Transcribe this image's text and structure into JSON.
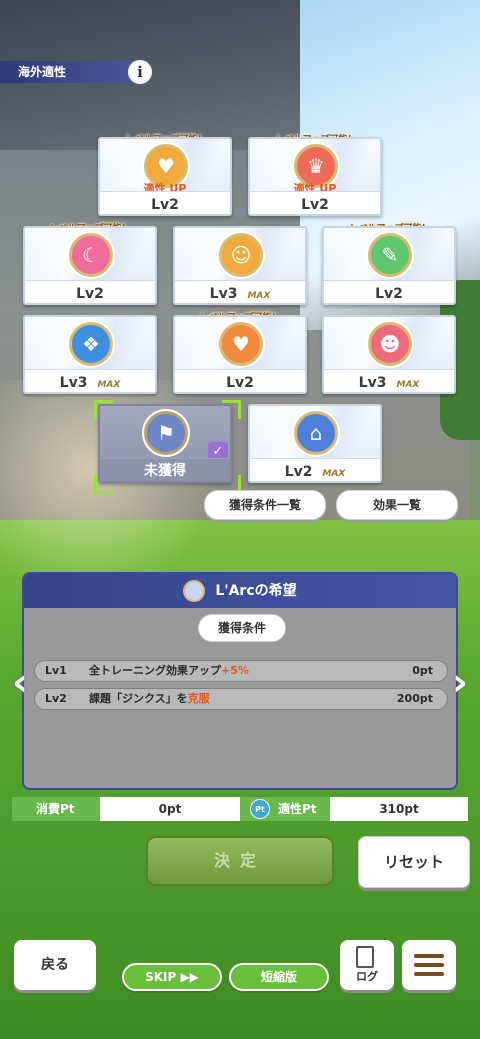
{
  "header": {
    "title": "海外適性",
    "info_icon": "i"
  },
  "cards": [
    {
      "id": "c1",
      "lvup": "レベルアップ可能！",
      "sub": "適性 UP",
      "level": "Lv2",
      "max": "",
      "icon": "heart-icon",
      "color": "#f2a93b"
    },
    {
      "id": "c2",
      "lvup": "レベルアップ可能！",
      "sub": "適性 UP",
      "level": "Lv2",
      "max": "",
      "icon": "crown-icon",
      "color": "#ee6a5b"
    },
    {
      "id": "c3",
      "lvup": "レベルアップ可能！",
      "sub": "",
      "level": "Lv2",
      "max": "",
      "icon": "moon-icon",
      "color": "#ef6c9c"
    },
    {
      "id": "c4",
      "lvup": "",
      "sub": "",
      "level": "Lv3",
      "max": "MAX",
      "icon": "rabbit-icon",
      "color": "#f2a93b"
    },
    {
      "id": "c5",
      "lvup": "レベルアップ可能！",
      "sub": "",
      "level": "Lv2",
      "max": "",
      "icon": "chat-icon",
      "color": "#5fc76e"
    },
    {
      "id": "c6",
      "lvup": "",
      "sub": "",
      "level": "Lv3",
      "max": "MAX",
      "icon": "cube-icon",
      "color": "#3f8fe0"
    },
    {
      "id": "c7",
      "lvup": "レベルアップ可能！",
      "sub": "",
      "level": "Lv2",
      "max": "",
      "icon": "heart-icon",
      "color": "#f28a3b"
    },
    {
      "id": "c8",
      "lvup": "",
      "sub": "",
      "level": "Lv3",
      "max": "MAX",
      "icon": "face-icon",
      "color": "#ee6a7a"
    },
    {
      "id": "c9",
      "lvup": "",
      "sub": "",
      "level": "未獲得",
      "max": "",
      "icon": "flag-icon",
      "color": "#6f85c8"
    },
    {
      "id": "c10",
      "lvup": "",
      "sub": "",
      "level": "Lv2",
      "max": "MAX",
      "icon": "arch-icon",
      "color": "#4f7fd8"
    }
  ],
  "buttons": {
    "conditions": "獲得条件一覧",
    "effects": "効果一覧",
    "decide": "決定",
    "reset": "リセット",
    "back": "戻る",
    "skip": "SKIP ▶▶",
    "short": "短縮版",
    "log": "ログ"
  },
  "panel": {
    "title": "L'Arcの希望",
    "tab": "獲得条件",
    "rows": [
      {
        "lv": "Lv1",
        "text_a": "全トレーニング効果アップ",
        "text_b": "+5%",
        "pt": "0pt"
      },
      {
        "lv": "Lv2",
        "text_a": "課題「ジンクス」を",
        "text_b": "克服",
        "pt": "200pt"
      }
    ]
  },
  "points": {
    "cost_label": "消費Pt",
    "cost_value": "0pt",
    "apt_badge": "Pt",
    "apt_label": "適性Pt",
    "apt_value": "310pt"
  }
}
